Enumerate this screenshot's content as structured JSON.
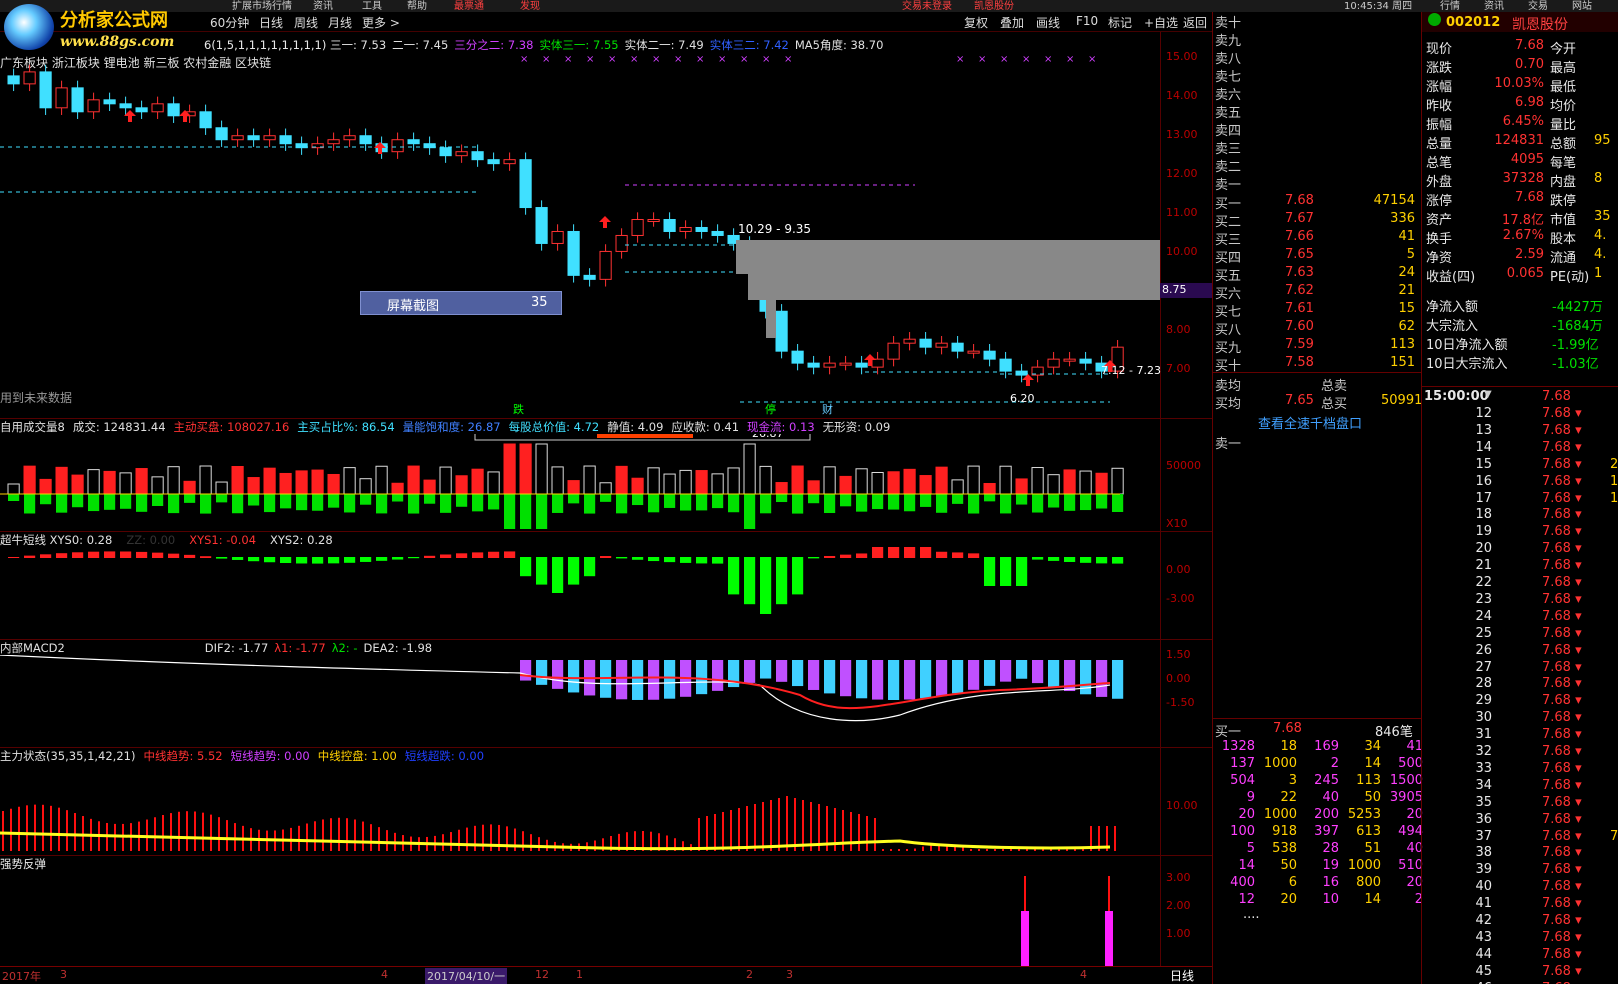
{
  "topbar": {
    "items": [
      "扩展市场行情",
      "资讯",
      "工具",
      "帮助"
    ],
    "center_labels": [
      "最票通",
      "发现",
      "交易未登录",
      "凯恩股份"
    ],
    "time": "10:45:34 周四",
    "right_tabs": [
      "行情",
      "资讯",
      "交易",
      "网站"
    ]
  },
  "logo": {
    "line1": "分析家公式网",
    "line2": "www.88gs.com"
  },
  "periods": [
    "60分钟",
    "日线",
    "周线",
    "月线",
    "更多 >"
  ],
  "toolbar": [
    "复权",
    "叠加",
    "画线",
    "F10",
    "标记",
    "+自选",
    "返回"
  ],
  "main_indicator": {
    "params": "6(1,5,1,1,1,1,1,1,1,1)",
    "items": [
      {
        "label": "三一: 7.53",
        "color": "#e0e0e0"
      },
      {
        "label": "二一: 7.45",
        "color": "#e0e0e0"
      },
      {
        "label": "三分之二: 7.38",
        "color": "#d040ff"
      },
      {
        "label": "实体三一: 7.55",
        "color": "#00e000"
      },
      {
        "label": "实体二一: 7.49",
        "color": "#e0e0e0"
      },
      {
        "label": "实体三二: 7.42",
        "color": "#3060ff"
      },
      {
        "label": "MA5角度: 38.70",
        "color": "#e0e0e0"
      }
    ],
    "concepts": "广东板块 浙江板块 锂电池 新三板 农村金融 区块链",
    "range_label": "10.29 - 9.35",
    "range_label2": "7.12 - 7.23",
    "low_label": "6.20",
    "price_tag": "8.75",
    "screenshot_popup": {
      "label": "屏幕截图",
      "value": "35"
    },
    "future_note": "用到未来数据",
    "event_tags": [
      "跌",
      "停",
      "财"
    ]
  },
  "price_axis": [
    "15.00",
    "14.00",
    "13.00",
    "12.00",
    "11.00",
    "10.00",
    "9.00",
    "8.00",
    "7.00"
  ],
  "volume_panel": {
    "items": [
      {
        "label": "自用成交量8",
        "color": "#e0e0e0"
      },
      {
        "label": "成交: 124831.44",
        "color": "#e0e0e0"
      },
      {
        "label": "主动买盘: 108027.16",
        "color": "#ff3232"
      },
      {
        "label": "主买占比%: 86.54",
        "color": "#40e0ff"
      },
      {
        "label": "量能饱和度: 26.87",
        "color": "#4080ff"
      },
      {
        "label": "每股总价值: 4.72",
        "color": "#40e0ff"
      },
      {
        "label": "静值: 4.09",
        "color": "#e0e0e0"
      },
      {
        "label": "应收款: 0.41",
        "color": "#e0e0e0"
      },
      {
        "label": "现金流: 0.13",
        "color": "#d040ff"
      },
      {
        "label": "无形资: 0.09",
        "color": "#e0e0e0"
      }
    ],
    "bar_value": "26.87",
    "axis": [
      "50000",
      "X10"
    ]
  },
  "xys_panel": {
    "items": [
      {
        "label": "超牛短线 XYS0: 0.28",
        "color": "#e0e0e0"
      },
      {
        "label": "ZZ: 0.00",
        "color": "#333333"
      },
      {
        "label": "XYS1: -0.04",
        "color": "#ff3232"
      },
      {
        "label": "XYS2: 0.28",
        "color": "#e0e0e0"
      }
    ],
    "axis": [
      "0.00",
      "-3.00"
    ]
  },
  "macd_panel": {
    "items": [
      {
        "label": "内部MACD2",
        "color": "#e0e0e0"
      },
      {
        "label": "DIF2: -1.77",
        "color": "#e0e0e0"
      },
      {
        "label": "λ1: -1.77",
        "color": "#ff3232"
      },
      {
        "label": "λ2: -",
        "color": "#00e000"
      },
      {
        "label": "DEA2: -1.98",
        "color": "#e0e0e0"
      }
    ],
    "axis": [
      "1.50",
      "0.00",
      "-1.50"
    ]
  },
  "zl_panel": {
    "items": [
      {
        "label": "主力状态(35,35,1,42,21)",
        "color": "#e0e0e0"
      },
      {
        "label": "中线趋势: 5.52",
        "color": "#ff3232"
      },
      {
        "label": "短线趋势: 0.00",
        "color": "#d040ff"
      },
      {
        "label": "中线控盘: 1.00",
        "color": "#ffd000"
      },
      {
        "label": "短线超跌: 0.00",
        "color": "#2040ff"
      }
    ],
    "axis": [
      "10.00"
    ]
  },
  "fs_panel": {
    "title": "强势反弹",
    "axis": [
      "3.00",
      "2.00",
      "1.00"
    ]
  },
  "datebar": {
    "labels": [
      "2017年",
      "3",
      "4",
      "2017/04/10/一",
      "12",
      "1",
      "2",
      "3",
      "4"
    ],
    "period": "日线"
  },
  "orderbook": {
    "sell_labels": [
      "卖十",
      "卖九",
      "卖八",
      "卖七",
      "卖六",
      "卖五",
      "卖四",
      "卖三",
      "卖二",
      "卖一"
    ],
    "buy": [
      {
        "label": "买一",
        "price": "7.68",
        "vol": "47154"
      },
      {
        "label": "买二",
        "price": "7.67",
        "vol": "336"
      },
      {
        "label": "买三",
        "price": "7.66",
        "vol": "41"
      },
      {
        "label": "买四",
        "price": "7.65",
        "vol": "5"
      },
      {
        "label": "买五",
        "price": "7.63",
        "vol": "24"
      },
      {
        "label": "买六",
        "price": "7.62",
        "vol": "21"
      },
      {
        "label": "买七",
        "price": "7.61",
        "vol": "15"
      },
      {
        "label": "买八",
        "price": "7.60",
        "vol": "62"
      },
      {
        "label": "买九",
        "price": "7.59",
        "vol": "113"
      },
      {
        "label": "买十",
        "price": "7.58",
        "vol": "151"
      }
    ],
    "sell_avg_label": "卖均",
    "total_sell_label": "总卖",
    "buy_avg_label": "买均",
    "buy_avg": "7.65",
    "total_buy_label": "总买",
    "total_buy": "50991",
    "link": "查看全速千档盘口",
    "sell1_label": "卖一",
    "queue_header": {
      "label": "买一",
      "price": "7.68",
      "count": "846笔"
    },
    "queue": [
      [
        "1328",
        "18",
        "169",
        "34",
        "41"
      ],
      [
        "137",
        "1000",
        "2",
        "14",
        "500"
      ],
      [
        "504",
        "3",
        "245",
        "113",
        "1500"
      ],
      [
        "9",
        "22",
        "40",
        "50",
        "3905"
      ],
      [
        "20",
        "1000",
        "200",
        "5253",
        "20"
      ],
      [
        "100",
        "918",
        "397",
        "613",
        "494"
      ],
      [
        "5",
        "538",
        "28",
        "51",
        "40"
      ],
      [
        "14",
        "50",
        "19",
        "1000",
        "510"
      ],
      [
        "400",
        "6",
        "16",
        "800",
        "20"
      ],
      [
        "12",
        "20",
        "10",
        "14",
        "2"
      ]
    ],
    "queue_more": "...."
  },
  "quote": {
    "code": "002012",
    "name": "凯恩股份",
    "rows": [
      {
        "l1": "现价",
        "v1": "7.68",
        "l2": "今开",
        "v2": ""
      },
      {
        "l1": "涨跌",
        "v1": "0.70",
        "l2": "最高",
        "v2": ""
      },
      {
        "l1": "涨幅",
        "v1": "10.03%",
        "l2": "最低",
        "v2": ""
      },
      {
        "l1": "昨收",
        "v1": "6.98",
        "l2": "均价",
        "v2": ""
      },
      {
        "l1": "振幅",
        "v1": "6.45%",
        "l2": "量比",
        "v2": ""
      },
      {
        "l1": "总量",
        "v1": "124831",
        "l2": "总额",
        "v2": "95"
      },
      {
        "l1": "总笔",
        "v1": "4095",
        "l2": "每笔",
        "v2": ""
      },
      {
        "l1": "外盘",
        "v1": "37328",
        "l2": "内盘",
        "v2": "8"
      },
      {
        "l1": "涨停",
        "v1": "7.68",
        "l2": "跌停",
        "v2": ""
      },
      {
        "l1": "资产",
        "v1": "17.8亿",
        "l2": "市值",
        "v2": "35"
      },
      {
        "l1": "换手",
        "v1": "2.67%",
        "l2": "股本",
        "v2": "4."
      },
      {
        "l1": "净资",
        "v1": "2.59",
        "l2": "流通",
        "v2": "4."
      },
      {
        "l1": "收益(四)",
        "v1": "0.065",
        "l2": "PE(动)",
        "v2": "1"
      }
    ],
    "flows": [
      {
        "label": "净流入额",
        "value": "-4427万"
      },
      {
        "label": "大宗流入",
        "value": "-1684万"
      },
      {
        "label": "10日净流入额",
        "value": "-1.99亿"
      },
      {
        "label": "10日大宗流入",
        "value": "-1.03亿"
      }
    ]
  },
  "ticks": {
    "header_time": "15:00:00",
    "header_price": "7.68",
    "minutes": [
      "12",
      "13",
      "14",
      "15",
      "16",
      "17",
      "18",
      "19",
      "20",
      "21",
      "22",
      "23",
      "24",
      "25",
      "26",
      "27",
      "28",
      "29",
      "30",
      "31",
      "32",
      "33",
      "34",
      "35",
      "36",
      "37",
      "38",
      "39",
      "40",
      "41",
      "42",
      "43",
      "44",
      "45",
      "46"
    ],
    "price": "7.68",
    "partial_vols": {
      "15": "2",
      "16": "19",
      "17": "1",
      "37": "7"
    }
  },
  "colors": {
    "up": "#ff3232",
    "down": "#40e0ff",
    "bg": "#000000",
    "grid": "#550000"
  }
}
